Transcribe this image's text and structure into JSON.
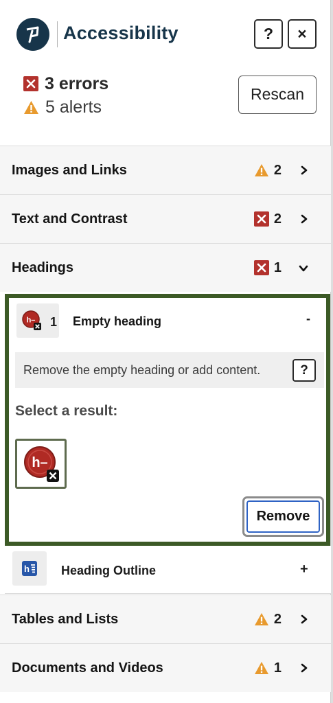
{
  "header": {
    "app_title": "Accessibility",
    "help_label": "?",
    "close_label": "×"
  },
  "summary": {
    "errors_text": "3 errors",
    "alerts_text": "5 alerts",
    "rescan_label": "Rescan"
  },
  "categories": [
    {
      "label": "Images and Links",
      "badge": "alert",
      "count": "2",
      "state": "collapsed"
    },
    {
      "label": "Text and Contrast",
      "badge": "error",
      "count": "2",
      "state": "collapsed"
    },
    {
      "label": "Headings",
      "badge": "error",
      "count": "1",
      "state": "expanded"
    },
    {
      "label": "Tables and Lists",
      "badge": "alert",
      "count": "2",
      "state": "collapsed"
    },
    {
      "label": "Documents and Videos",
      "badge": "alert",
      "count": "1",
      "state": "collapsed"
    }
  ],
  "issue": {
    "count": "1",
    "title": "Empty heading",
    "toggle": "-",
    "description": "Remove the empty heading or add content.",
    "help_label": "?",
    "select_label": "Select a result:",
    "result_icon_text": "h–",
    "remove_label": "Remove"
  },
  "outline": {
    "title": "Heading Outline",
    "toggle": "+"
  },
  "colors": {
    "brand": "#17354a",
    "error": "#b3322d",
    "alert": "#e89a2e",
    "focus_border": "#3c5a26",
    "remove_focus": "#2f63c4",
    "outline_icon": "#2756a8"
  },
  "icons": {
    "logo": "brand-logo-icon",
    "error": "error-x-icon",
    "alert": "warning-triangle-icon",
    "chevron_right": "chevron-right-icon",
    "chevron_down": "chevron-down-icon",
    "empty_heading": "empty-heading-icon",
    "heading_outline": "heading-outline-icon"
  }
}
